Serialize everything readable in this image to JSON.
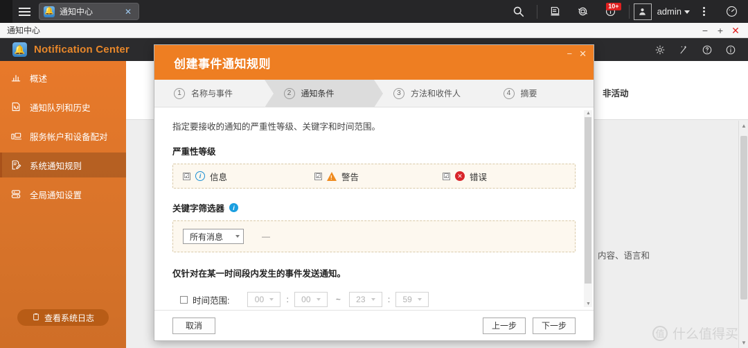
{
  "desktop": {
    "menu_icon": "hamburger-icon",
    "tab": {
      "title": "通知中心",
      "icon": "bell-app-icon",
      "close": "✕"
    },
    "toolbar": {
      "search": "search-icon",
      "resource_monitor": "resource-monitor-icon",
      "backup": "backup-sync-icon",
      "notifications": "notification-info-icon",
      "notification_badge": "10+",
      "user_icon": "user-avatar-icon",
      "user_name": "admin",
      "options": "kebab-menu-icon",
      "dashboard": "gauge-icon"
    }
  },
  "window": {
    "title": "通知中心",
    "minimize": "−",
    "maximize": "+",
    "close": "✕"
  },
  "app": {
    "name": "Notification Center",
    "logo": "bell-gear-icon",
    "header_icons": [
      "settings-gear-icon",
      "wizard-wand-icon",
      "help-question-icon",
      "about-info-icon"
    ]
  },
  "sidebar": {
    "items": [
      {
        "label": "概述",
        "icon": "chart-bars-icon",
        "active": false
      },
      {
        "label": "通知队列和历史",
        "icon": "history-queue-icon",
        "active": false
      },
      {
        "label": "服务帐户和设备配对",
        "icon": "devices-pairing-icon",
        "active": false
      },
      {
        "label": "系统通知规则",
        "icon": "rules-edit-icon",
        "active": true
      },
      {
        "label": "全局通知设置",
        "icon": "global-settings-icon",
        "active": false
      }
    ],
    "log_button": {
      "label": "查看系统日志",
      "icon": "clipboard-icon"
    }
  },
  "content": {
    "inactive_label": "非活动",
    "fragment_text": "去、内容、语言和"
  },
  "watermark": {
    "mark": "值",
    "text": "什么值得买"
  },
  "dialog": {
    "title": "创建事件通知规则",
    "minimize": "−",
    "close": "✕",
    "steps": [
      {
        "num": "1",
        "label": "名称与事件",
        "active": false
      },
      {
        "num": "2",
        "label": "通知条件",
        "active": true
      },
      {
        "num": "3",
        "label": "方法和收件人",
        "active": false
      },
      {
        "num": "4",
        "label": "摘要",
        "active": false
      }
    ],
    "intro": "指定要接收的通知的严重性等级、关键字和时间范围。",
    "severity": {
      "label": "严重性等级",
      "options": [
        {
          "label": "信息",
          "icon": "info-circle-icon",
          "checked": true,
          "mark": "☑",
          "glyph": "i",
          "color": "#1b8fd4"
        },
        {
          "label": "警告",
          "icon": "warning-triangle-icon",
          "checked": true,
          "mark": "☑",
          "glyph": "!",
          "color": "#ef8b1f"
        },
        {
          "label": "错误",
          "icon": "error-circle-icon",
          "checked": true,
          "mark": "☑",
          "glyph": "✕",
          "color": "#d8252a"
        }
      ]
    },
    "keyword": {
      "label": "关键字筛选器",
      "info_icon": "info-tooltip-icon",
      "select_value": "所有消息",
      "dash": "—"
    },
    "time": {
      "note": "仅针对在某一时间段内发生的事件发送通知。",
      "checkbox_checked": false,
      "label": "时间范围:",
      "start_hour": "00",
      "start_minute": "00",
      "separator": "~",
      "end_hour": "23",
      "end_minute": "59",
      "colon": ":"
    },
    "footer": {
      "cancel": "取消",
      "previous": "上一步",
      "next": "下一步"
    }
  }
}
